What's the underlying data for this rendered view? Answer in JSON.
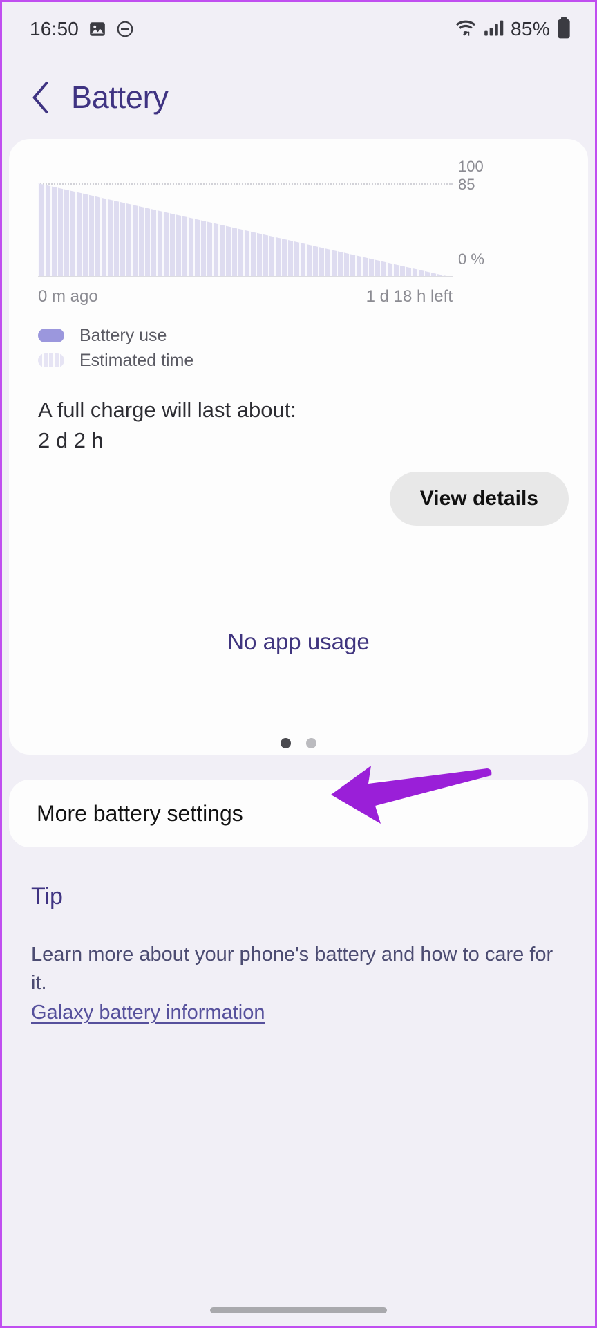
{
  "status_bar": {
    "time": "16:50",
    "battery_percent": "85%",
    "icons": [
      "image-icon",
      "do-not-disturb-icon",
      "wifi-icon",
      "cellular-signal-icon",
      "battery-icon"
    ]
  },
  "header": {
    "title": "Battery",
    "back_icon": "chevron-left-icon"
  },
  "chart_data": {
    "type": "area",
    "title": "",
    "xlabel": "",
    "ylabel": "%",
    "x_tick_labels": [
      "0 m ago",
      "1 d 18 h left"
    ],
    "y_tick_labels": [
      "100",
      "85",
      "0 %"
    ],
    "ylim": [
      0,
      100
    ],
    "gridlines": [
      {
        "value": 100,
        "style": "solid",
        "label": "100"
      },
      {
        "value": 85,
        "style": "dotted",
        "label": "85"
      },
      {
        "value": 50,
        "style": "solid",
        "label": ""
      },
      {
        "value": 0,
        "style": "solid",
        "label": "0 %"
      }
    ],
    "series": [
      {
        "name": "Battery use",
        "color": "#9b97dd",
        "values": [
          85
        ]
      },
      {
        "name": "Estimated time",
        "color": "#dedcf0",
        "values": [
          85,
          0
        ]
      }
    ],
    "x": [
      "0 m ago",
      "1 d 18 h left"
    ],
    "values": [
      85,
      0
    ],
    "legend": [
      {
        "label": "Battery use",
        "swatch": "solid",
        "color": "#9b97dd"
      },
      {
        "label": "Estimated time",
        "swatch": "striped",
        "color": "#e6e4f4"
      }
    ],
    "grid": true,
    "legend_position": "below-left"
  },
  "battery_card": {
    "full_charge_label": "A full charge will last about:",
    "full_charge_value": "2 d 2 h",
    "view_details_label": "View details",
    "no_app_usage": "No app usage",
    "page_dots": {
      "count": 2,
      "active_index": 0
    }
  },
  "more_settings": {
    "label": "More battery settings",
    "annotation_icon": "purple-arrow-annotation"
  },
  "tip": {
    "heading": "Tip",
    "body": "Learn more about your phone's battery and how to care for it.",
    "link": "Galaxy battery information"
  },
  "nav": {
    "gesture_bar": "home-gesture-bar"
  },
  "colors": {
    "accent": "#3f3382",
    "annotation": "#9a1fd8",
    "chart_fill": "#dedcf0",
    "page_bg": "#f1eff6",
    "card_bg": "#fdfdfd"
  }
}
